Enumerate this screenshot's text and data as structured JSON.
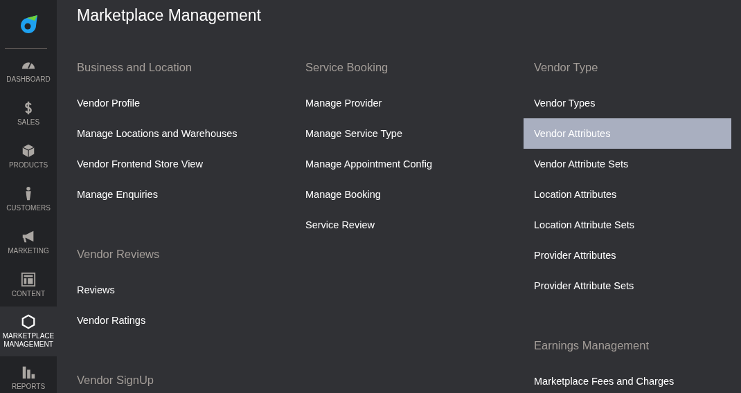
{
  "sidebar": {
    "items": [
      {
        "label": "DASHBOARD",
        "selected": false
      },
      {
        "label": "SALES",
        "selected": false
      },
      {
        "label": "PRODUCTS",
        "selected": false
      },
      {
        "label": "CUSTOMERS",
        "selected": false
      },
      {
        "label": "MARKETING",
        "selected": false
      },
      {
        "label": "CONTENT",
        "selected": false
      },
      {
        "label": "MARKETPLACE MANAGEMENT",
        "selected": true
      },
      {
        "label": "REPORTS",
        "selected": false
      }
    ]
  },
  "page": {
    "title": "Marketplace Management"
  },
  "columns": [
    {
      "groups": [
        {
          "heading": "Business and Location",
          "items": [
            {
              "label": "Vendor Profile",
              "selected": false
            },
            {
              "label": "Manage Locations and Warehouses",
              "selected": false
            },
            {
              "label": "Vendor Frontend Store View",
              "selected": false
            },
            {
              "label": "Manage Enquiries",
              "selected": false
            }
          ]
        },
        {
          "heading": "Vendor Reviews",
          "items": [
            {
              "label": "Reviews",
              "selected": false
            },
            {
              "label": "Vendor Ratings",
              "selected": false
            }
          ]
        },
        {
          "heading": "Vendor SignUp"
        }
      ]
    },
    {
      "groups": [
        {
          "heading": "Service Booking",
          "items": [
            {
              "label": "Manage Provider",
              "selected": false
            },
            {
              "label": "Manage Service Type",
              "selected": false
            },
            {
              "label": "Manage Appointment Config",
              "selected": false
            },
            {
              "label": "Manage Booking",
              "selected": false
            },
            {
              "label": "Service Review",
              "selected": false
            }
          ]
        }
      ]
    },
    {
      "groups": [
        {
          "heading": "Vendor Type",
          "items": [
            {
              "label": "Vendor Types",
              "selected": false
            },
            {
              "label": "Vendor Attributes",
              "selected": true
            },
            {
              "label": "Vendor Attribute Sets",
              "selected": false
            },
            {
              "label": "Location Attributes",
              "selected": false
            },
            {
              "label": "Location Attribute Sets",
              "selected": false
            },
            {
              "label": "Provider Attributes",
              "selected": false
            },
            {
              "label": "Provider Attribute Sets",
              "selected": false
            }
          ]
        },
        {
          "heading": "Earnings Management",
          "items": [
            {
              "label": "Marketplace Fees and Charges",
              "selected": false
            }
          ]
        }
      ]
    }
  ]
}
